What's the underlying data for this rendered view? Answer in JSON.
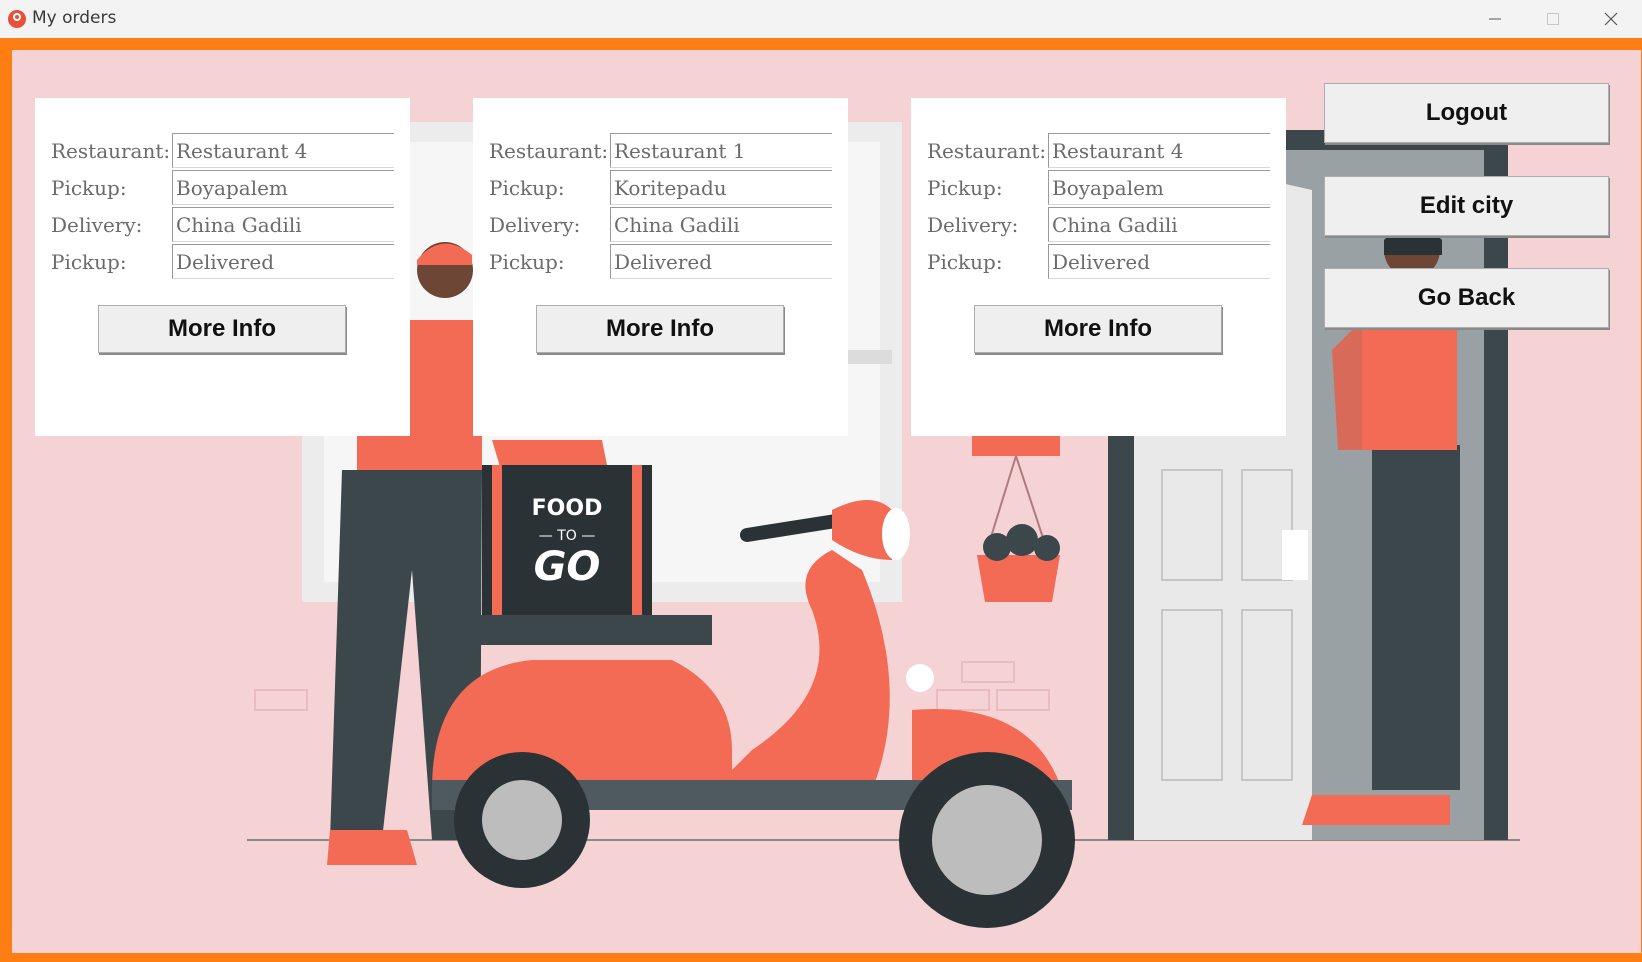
{
  "window": {
    "title": "My orders"
  },
  "orders": [
    {
      "restaurant_label": "Restaurant:",
      "restaurant": "Restaurant 4",
      "pickup_label": "Pickup:",
      "pickup": "Boyapalem",
      "delivery_label": "Delivery:",
      "delivery": "China Gadili",
      "status_label": "Pickup:",
      "status": "Delivered",
      "button_label": "More Info"
    },
    {
      "restaurant_label": "Restaurant:",
      "restaurant": "Restaurant 1",
      "pickup_label": "Pickup:",
      "pickup": "Koritepadu",
      "delivery_label": "Delivery:",
      "delivery": "China Gadili",
      "status_label": "Pickup:",
      "status": "Delivered",
      "button_label": "More Info"
    },
    {
      "restaurant_label": "Restaurant:",
      "restaurant": "Restaurant 4",
      "pickup_label": "Pickup:",
      "pickup": "Boyapalem",
      "delivery_label": "Delivery:",
      "delivery": "China Gadili",
      "status_label": "Pickup:",
      "status": "Delivered",
      "button_label": "More Info"
    }
  ],
  "actions": {
    "logout": "Logout",
    "edit_city": "Edit city",
    "go_back": "Go Back"
  },
  "illustration": {
    "box_text_top": "FOOD",
    "box_text_mid": "— TO —",
    "box_text_bottom": "GO"
  },
  "colors": {
    "accent": "#ff7e14",
    "background": "#f5d2d4",
    "coral": "#f36b55",
    "dark": "#3c474c"
  }
}
